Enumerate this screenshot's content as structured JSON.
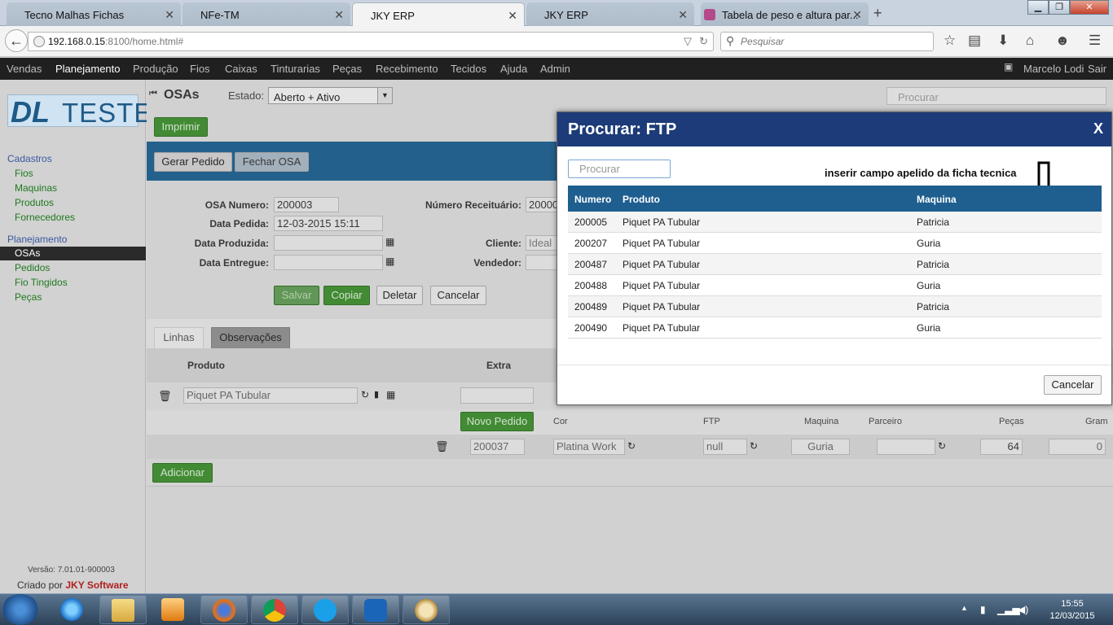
{
  "browser": {
    "tabs": [
      {
        "title": "Tecno Malhas Fichas",
        "active": false
      },
      {
        "title": "NFe-TM",
        "active": false
      },
      {
        "title": "JKY ERP",
        "active": true
      },
      {
        "title": "JKY ERP",
        "active": false
      },
      {
        "title": "Tabela de peso e altura par...",
        "active": false
      }
    ],
    "new_tab": "+",
    "close_glyph": "✕",
    "window_buttons": [
      "▁",
      "❐",
      "✕"
    ],
    "back": "←",
    "url_host": "192.168.0.15",
    "url_rest": ":8100/home.html#",
    "search_placeholder": "Pesquisar",
    "search_icon": "⚲"
  },
  "menubar": {
    "items": [
      "Vendas",
      "Planejamento",
      "Produção",
      "Fios",
      "Caixas",
      "Tinturarias",
      "Peças",
      "Recebimento",
      "Tecidos",
      "Ajuda",
      "Admin"
    ],
    "user": "Marcelo Lodi",
    "logout": "Sair"
  },
  "sidebar": {
    "logo_dl": "DL",
    "logo_teste": "TESTE",
    "cadastros_title": "Cadastros",
    "cadastros": [
      "Fios",
      "Maquinas",
      "Produtos",
      "Fornecedores"
    ],
    "planejamento_title": "Planejamento",
    "planejamento": [
      "OSAs",
      "Pedidos",
      "Fio Tingidos",
      "Peças"
    ],
    "version": "Versão: 7.01.01-900003",
    "credit_prefix": "Criado por",
    "credit_company": "JKY Software"
  },
  "main": {
    "title": "OSAs",
    "estado_label": "Estado:",
    "estado_value": "Aberto + Ativo",
    "search_placeholder": "Procurar",
    "print_button": "Imprimir",
    "gerar_pedido": "Gerar Pedido",
    "fechar_osa": "Fechar OSA",
    "form": {
      "osa_numero_label": "OSA Numero:",
      "osa_numero": "200003",
      "data_pedida_label": "Data Pedida:",
      "data_pedida": "12-03-2015 15:11",
      "data_produzida_label": "Data Produzida:",
      "data_entregue_label": "Data Entregue:",
      "numero_receituario_label": "Número Receituário:",
      "numero_receituario": "20000",
      "cliente_label": "Cliente:",
      "cliente": "Ideal V",
      "vendedor_label": "Vendedor:"
    },
    "actions": {
      "salvar": "Salvar",
      "copiar": "Copiar",
      "deletar": "Deletar",
      "cancelar": "Cancelar"
    },
    "tabs": {
      "linhas": "Linhas",
      "observacoes": "Observações"
    },
    "lines_header": {
      "produto": "Produto",
      "extra": "Extra"
    },
    "line": {
      "produto": "Piquet PA Tubular"
    },
    "novo_pedido": "Novo Pedido",
    "sub_header": {
      "cor": "Cor",
      "ftp": "FTP",
      "maquina": "Maquina",
      "parceiro": "Parceiro",
      "pecas": "Peças",
      "gram": "Gram"
    },
    "sub_row": {
      "pedido": "200037",
      "cor": "Platina Work",
      "ftp": "null",
      "maquina": "Guria",
      "pecas": "64",
      "gram": "0"
    },
    "adicionar": "Adicionar"
  },
  "modal": {
    "title": "Procurar: FTP",
    "close": "X",
    "search_placeholder": "Procurar",
    "note": "inserir campo apelido da ficha tecnica",
    "columns": {
      "numero": "Numero",
      "produto": "Produto",
      "maquina": "Maquina"
    },
    "rows": [
      {
        "numero": "200005",
        "produto": "Piquet PA Tubular",
        "maquina": "Patricia"
      },
      {
        "numero": "200207",
        "produto": "Piquet PA Tubular",
        "maquina": "Guria"
      },
      {
        "numero": "200487",
        "produto": "Piquet PA Tubular",
        "maquina": "Patricia"
      },
      {
        "numero": "200488",
        "produto": "Piquet PA Tubular",
        "maquina": "Guria"
      },
      {
        "numero": "200489",
        "produto": "Piquet PA Tubular",
        "maquina": "Patricia"
      },
      {
        "numero": "200490",
        "produto": "Piquet PA Tubular",
        "maquina": "Guria"
      }
    ],
    "cancel": "Cancelar"
  },
  "taskbar": {
    "time": "15:55",
    "date": "12/03/2015"
  },
  "icons": {
    "back": "arrow-left-icon",
    "star": "star-icon",
    "home": "home-icon",
    "menu": "hamburger-icon",
    "calendar": "calendar-icon",
    "trash": "trash-icon",
    "refresh": "refresh-icon"
  }
}
